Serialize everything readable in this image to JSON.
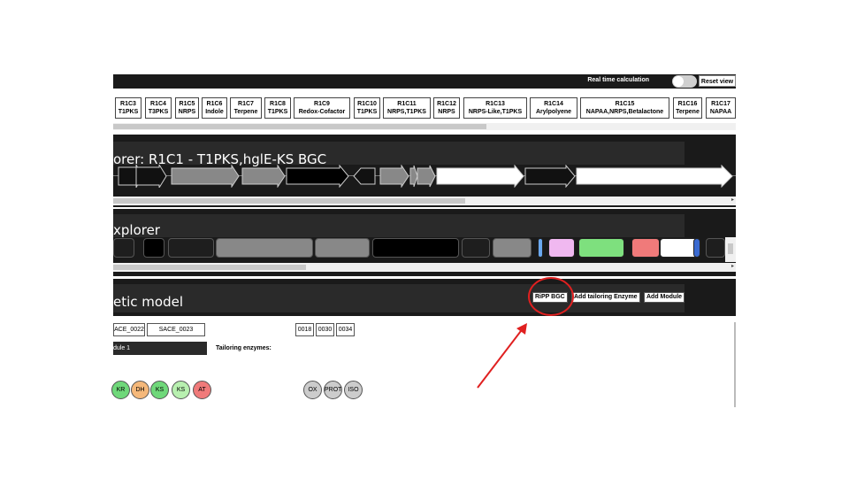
{
  "toolbar": {
    "realtime_label": "Real time calculation",
    "reset_label": "Reset view"
  },
  "regions": [
    {
      "id": "R1C3",
      "type": "T1PKS"
    },
    {
      "id": "R1C4",
      "type": "T3PKS"
    },
    {
      "id": "R1C5",
      "type": "NRPS"
    },
    {
      "id": "R1C6",
      "type": "Indole"
    },
    {
      "id": "R1C7",
      "type": "Terpene"
    },
    {
      "id": "R1C8",
      "type": "T1PKS"
    },
    {
      "id": "R1C9",
      "type": "Redox-Cofactor"
    },
    {
      "id": "R1C10",
      "type": "T1PKS"
    },
    {
      "id": "R1C11",
      "type": "NRPS,T1PKS"
    },
    {
      "id": "R1C12",
      "type": "NRPS"
    },
    {
      "id": "R1C13",
      "type": "NRPS-Like,T1PKS"
    },
    {
      "id": "R1C14",
      "type": "Arylpolyene"
    },
    {
      "id": "R1C15",
      "type": "NAPAA,NRPS,Betalactone"
    },
    {
      "id": "R1C16",
      "type": "Terpene"
    },
    {
      "id": "R1C17",
      "type": "NAPAA"
    }
  ],
  "bgc_explorer": {
    "title": "orer: R1C1 - T1PKS,hglE-KS BGC"
  },
  "domain_explorer": {
    "title": "xplorer"
  },
  "model": {
    "title": "etic model",
    "buttons": {
      "ripp": "RiPP BGC",
      "tailoring": "Add tailoring Enzyme",
      "module": "Add Module"
    },
    "genes": [
      "ACE_0022",
      "SACE_0023"
    ],
    "tailoring_genes": [
      "0018",
      "0030",
      "0034"
    ],
    "module_label": "dule 1",
    "tailoring_label": "Tailoring enzymes:",
    "domains": [
      {
        "label": "KR",
        "color": "#6fd87a"
      },
      {
        "label": "DH",
        "color": "#f5b87a"
      },
      {
        "label": "KS",
        "color": "#6fd87a"
      },
      {
        "label": "KS",
        "color": "#b8f0b0"
      },
      {
        "label": "AT",
        "color": "#f07a7a"
      }
    ],
    "tailoring_domains": [
      {
        "label": "OX",
        "color": "#cccccc"
      },
      {
        "label": "PROT",
        "color": "#cccccc"
      },
      {
        "label": "ISO",
        "color": "#cccccc"
      }
    ]
  },
  "annotation": {
    "color": "#e02020"
  }
}
